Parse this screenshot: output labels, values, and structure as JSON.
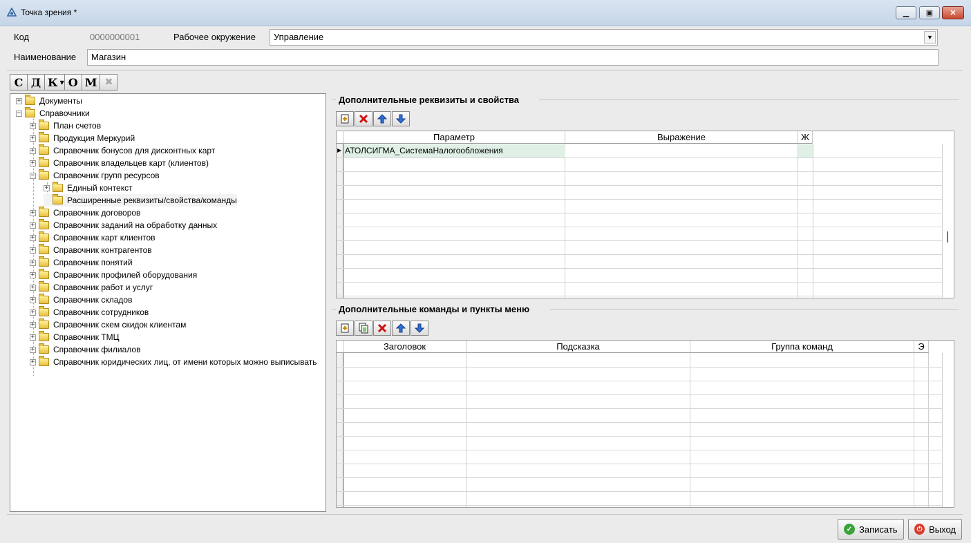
{
  "window": {
    "title": "Точка зрения *"
  },
  "form": {
    "code_label": "Код",
    "code_value": "0000000001",
    "env_label": "Рабочее окружение",
    "env_value": "Управление",
    "name_label": "Наименование",
    "name_value": "Магазин"
  },
  "toolbar": {
    "buttons": [
      "С",
      "Д",
      "К",
      "О",
      "М"
    ]
  },
  "tree": {
    "nodes": [
      "Документы",
      "Справочники",
      "План счетов",
      "Продукция Меркурий",
      "Справочник бонусов для дисконтных карт",
      "Справочник владельцев карт (клиентов)",
      "Справочник групп ресурсов",
      "Единый контекст",
      "Расширенные реквизиты/свойства/команды",
      "Справочник договоров",
      "Справочник заданий на обработку данных",
      "Справочник карт клиентов",
      "Справочник контрагентов",
      "Справочник понятий",
      "Справочник профилей оборудования",
      "Справочник работ и услуг",
      "Справочник складов",
      "Справочник сотрудников",
      "Справочник схем скидок клиентам",
      "Справочник ТМЦ",
      "Справочник филиалов",
      "Справочник юридических лиц, от имени которых можно выписывать"
    ]
  },
  "props_section": {
    "title": "Дополнительные реквизиты и свойства",
    "columns": [
      "Параметр",
      "Выражение",
      "Ж"
    ],
    "rows": [
      [
        "АТОЛСИГМА_СистемаНалогообложения",
        "",
        ""
      ]
    ]
  },
  "cmds_section": {
    "title": "Дополнительные команды и пункты меню",
    "columns": [
      "Заголовок",
      "Подсказка",
      "Группа команд",
      "Э"
    ]
  },
  "footer": {
    "save_label": "Записать",
    "exit_label": "Выход"
  },
  "colors": {
    "selected_row": "#e0f0e6",
    "titlebar": "#c5d5e8"
  }
}
